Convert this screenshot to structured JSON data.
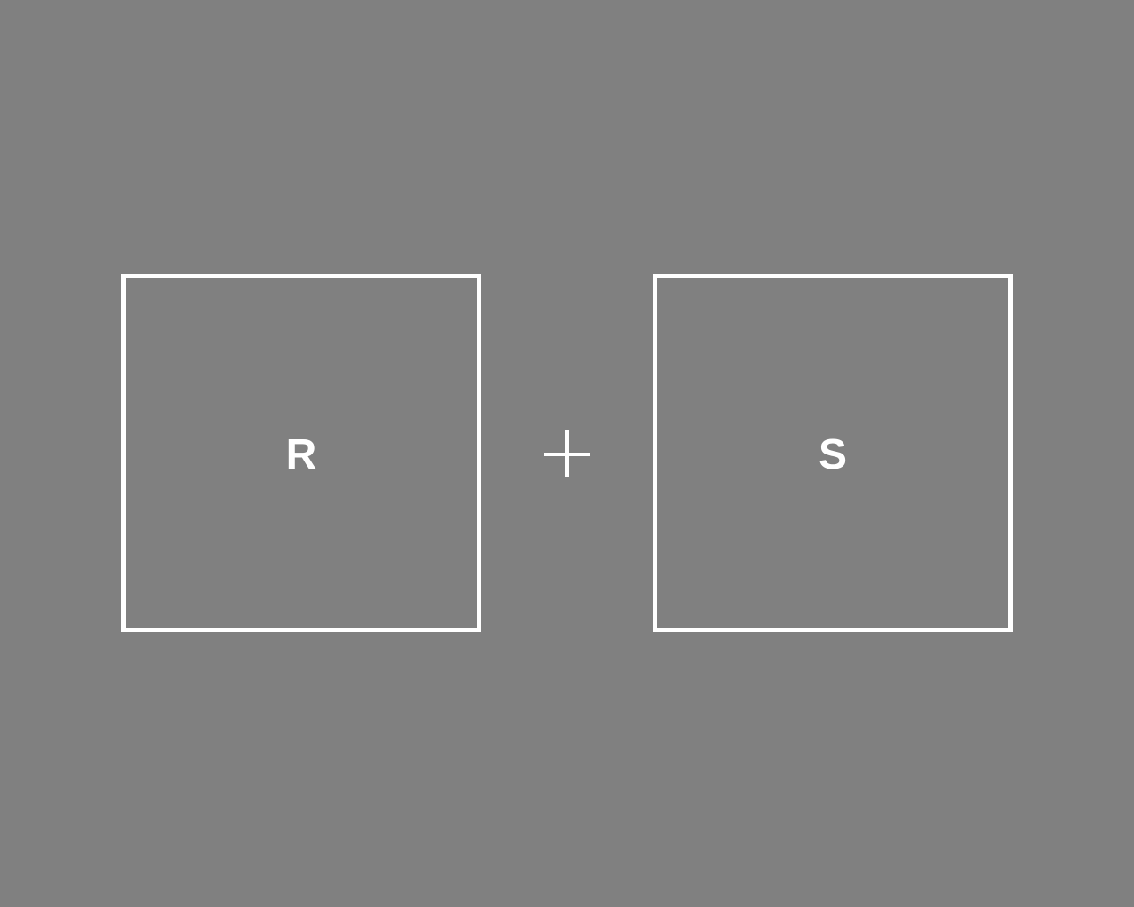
{
  "colors": {
    "background": "#808080",
    "foreground": "#ffffff"
  },
  "stimuli": {
    "left_letter": "R",
    "right_letter": "S"
  },
  "fixation": {
    "icon": "fixation-cross-icon"
  }
}
